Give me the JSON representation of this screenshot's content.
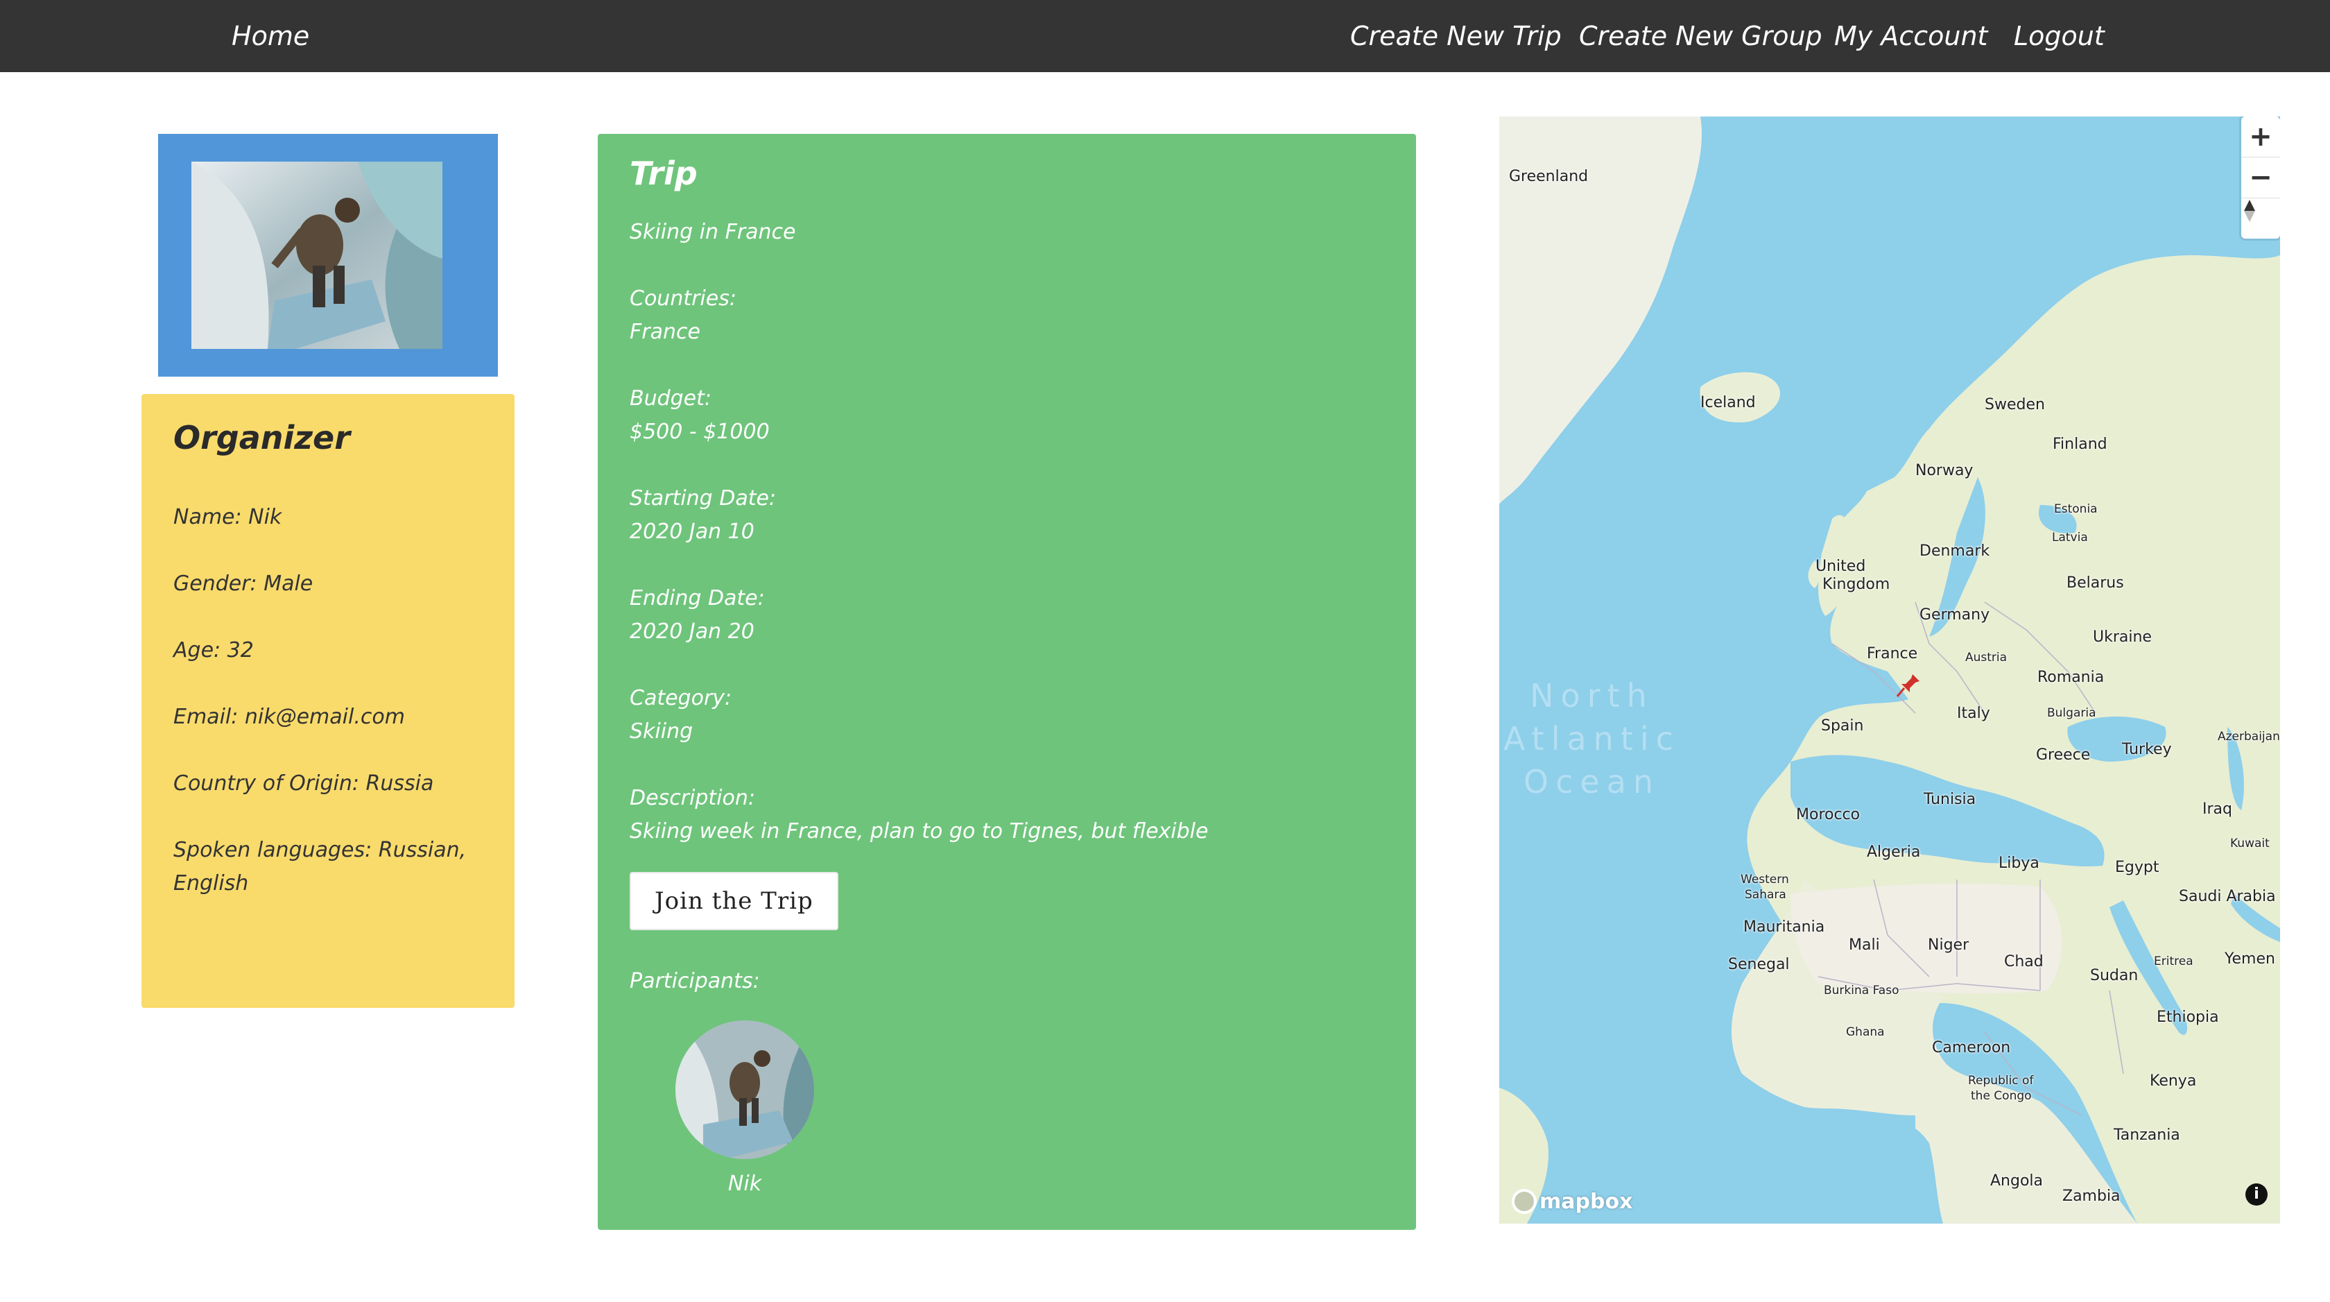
{
  "nav": {
    "home": "Home",
    "create_trip": "Create New Trip",
    "create_group": "Create New Group",
    "my_account": "My Account",
    "logout": "Logout"
  },
  "organizer": {
    "title": "Organizer",
    "name": "Name: Nik",
    "gender": "Gender: Male",
    "age": "Age: 32",
    "email": "Email: nik@email.com",
    "country": "Country of Origin: Russia",
    "languages": "Spoken languages: Russian, English"
  },
  "trip": {
    "title": "Trip",
    "name": "Skiing in France",
    "countries_label": "Countries:",
    "countries": "France",
    "budget_label": "Budget:",
    "budget": "$500 - $1000",
    "start_label": "Starting Date:",
    "start": "2020 Jan 10",
    "end_label": "Ending Date:",
    "end": "2020 Jan 20",
    "category_label": "Category:",
    "category": "Skiing",
    "description_label": "Description:",
    "description": "Skiing week in France, plan to go to Tignes, but flexible",
    "join_button": "Join the Trip",
    "participants_label": "Participants:",
    "participants": [
      {
        "name": "Nik"
      }
    ]
  },
  "map": {
    "ocean": "North Atlantic Ocean",
    "ocean_lines": [
      "North",
      "Atlantic",
      "Ocean"
    ],
    "zoom_in": "+",
    "zoom_out": "−",
    "logo": "mapbox",
    "info": "i",
    "labels": {
      "greenland": "Greenland",
      "iceland": "Iceland",
      "sweden": "Sweden",
      "finland": "Finland",
      "norway": "Norway",
      "estonia": "Estonia",
      "latvia": "Latvia",
      "uk_line1": "United",
      "uk_line2": "Kingdom",
      "denmark": "Denmark",
      "belarus": "Belarus",
      "germany": "Germany",
      "ukraine": "Ukraine",
      "france": "France",
      "austria": "Austria",
      "romania": "Romania",
      "spain": "Spain",
      "italy": "Italy",
      "bulgaria": "Bulgaria",
      "greece": "Greece",
      "turkey": "Turkey",
      "azerbaijan": "Azerbaijan",
      "tunisia": "Tunisia",
      "morocco": "Morocco",
      "iraq": "Iraq",
      "kuwait": "Kuwait",
      "algeria": "Algeria",
      "libya": "Libya",
      "egypt": "Egypt",
      "western_sahara_1": "Western",
      "western_sahara_2": "Sahara",
      "saudi_arabia": "Saudi Arabia",
      "mauritania": "Mauritania",
      "mali": "Mali",
      "niger": "Niger",
      "eritrea": "Eritrea",
      "yemen": "Yemen",
      "senegal": "Senegal",
      "chad": "Chad",
      "sudan": "Sudan",
      "burkina_faso": "Burkina Faso",
      "ethiopia": "Ethiopia",
      "ghana": "Ghana",
      "cameroon": "Cameroon",
      "congo_1": "Republic of",
      "congo_2": "the Congo",
      "kenya": "Kenya",
      "tanzania": "Tanzania",
      "angola": "Angola",
      "zambia": "Zambia"
    }
  },
  "colors": {
    "navbar": "#343434",
    "photo_card": "#5096d9",
    "organizer_card": "#f9db6c",
    "trip_card": "#6ec47b",
    "water": "#8ecfea",
    "land": "#eef0d8",
    "marker": "#d0312d"
  }
}
